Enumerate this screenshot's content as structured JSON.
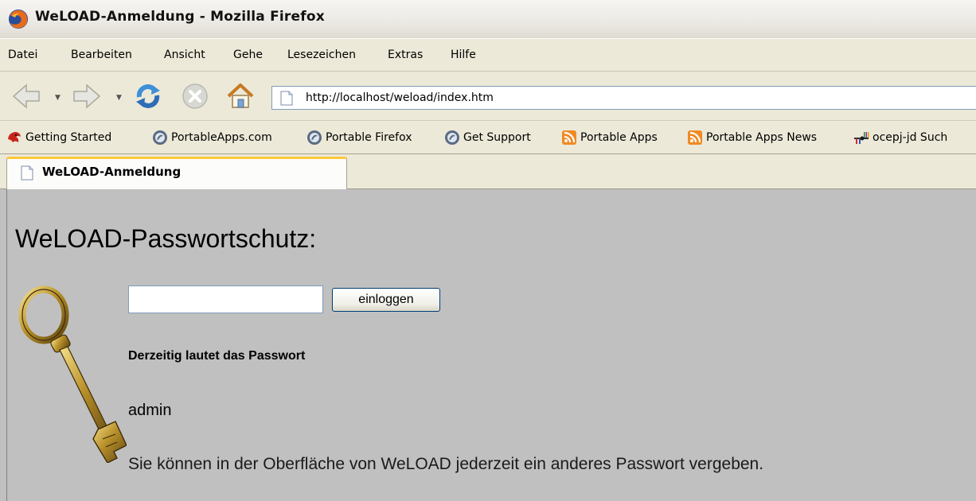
{
  "window": {
    "title": "WeLOAD-Anmeldung - Mozilla Firefox"
  },
  "menu": [
    "Datei",
    "Bearbeiten",
    "Ansicht",
    "Gehe",
    "Lesezeichen",
    "Extras",
    "Hilfe"
  ],
  "nav": {
    "url": "http://localhost/weload/index.htm"
  },
  "bookmarks": [
    {
      "label": "Getting Started",
      "icon": "firefox-getting-started-icon"
    },
    {
      "label": "PortableApps.com",
      "icon": "portableapps-icon"
    },
    {
      "label": "Portable Firefox",
      "icon": "portableapps-icon"
    },
    {
      "label": "Get Support",
      "icon": "portableapps-icon"
    },
    {
      "label": "Portable Apps",
      "icon": "rss-feed-icon"
    },
    {
      "label": "Portable Apps News",
      "icon": "rss-feed-icon"
    },
    {
      "label": "ocepj-jd Such",
      "icon": "search-engine-icon"
    }
  ],
  "tab": {
    "label": "WeLOAD-Anmeldung"
  },
  "page": {
    "title": "WeLOAD-Passwortschutz:",
    "password_value": "",
    "login_label": "einloggen",
    "current_label": "Derzeitig lautet das Passwort",
    "current_password": "admin",
    "note": "Sie können in der Oberfläche von WeLOAD jederzeit ein anderes Passwort vergeben."
  },
  "colors": {
    "accent_tab": "#ffc83d",
    "content_bg": "#c0c0c0",
    "chrome_bg": "#ece9d8"
  }
}
